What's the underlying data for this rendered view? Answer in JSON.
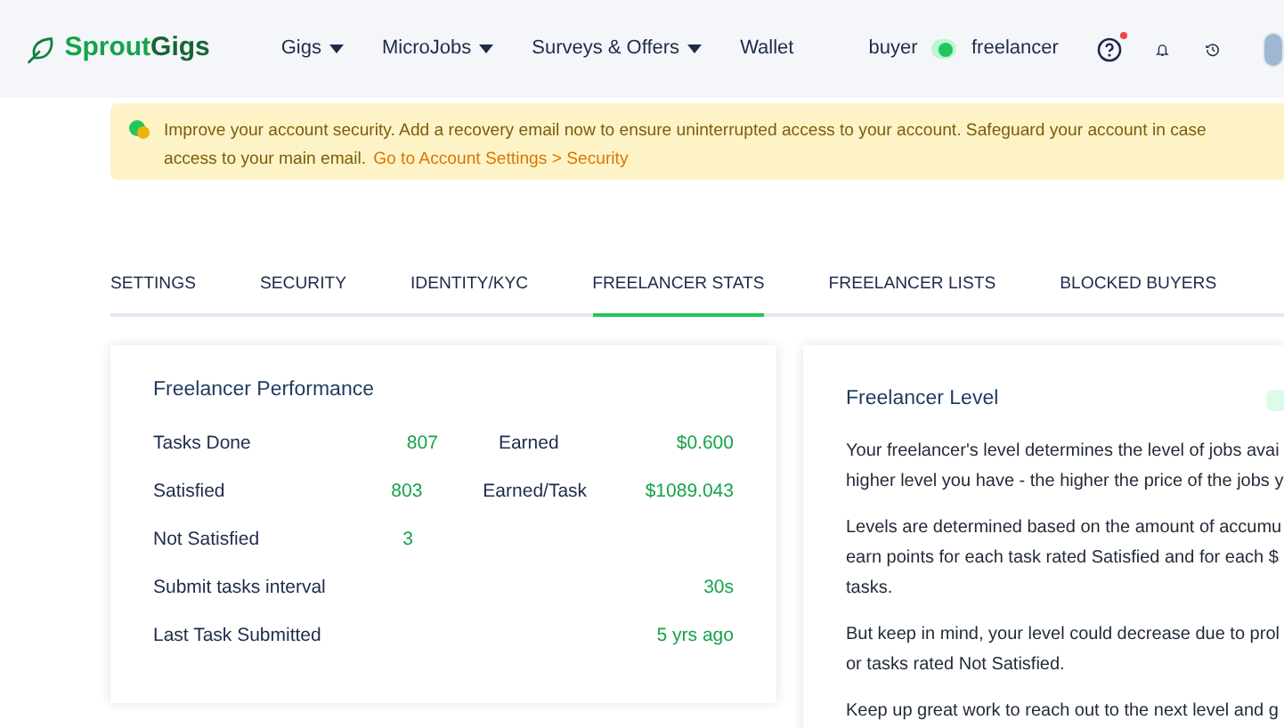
{
  "header": {
    "logo": {
      "part_1": "Sprout",
      "part_2": "Gigs"
    },
    "nav": [
      {
        "label": "Gigs",
        "dropdown": true
      },
      {
        "label": "MicroJobs",
        "dropdown": true
      },
      {
        "label": "Surveys & Offers",
        "dropdown": true
      },
      {
        "label": "Wallet",
        "dropdown": false
      }
    ],
    "role_switch": {
      "left": "buyer",
      "right": "freelancer",
      "on": true
    },
    "help_notification": true
  },
  "banner": {
    "lines": [
      "Improve your account security. Add a recovery email now to ensure uninterrupted access to your account. Safeguard your account in case"
    ],
    "last_line": "access to your main email.",
    "link": "Go to Account Settings > Security"
  },
  "tabs": [
    {
      "label": "SETTINGS",
      "selected": false
    },
    {
      "label": "SECURITY",
      "selected": false
    },
    {
      "label": "IDENTITY/KYC",
      "selected": false
    },
    {
      "label": "FREELANCER STATS",
      "selected": true
    },
    {
      "label": "FREELANCER LISTS",
      "selected": false
    },
    {
      "label": "BLOCKED BUYERS",
      "selected": false
    }
  ],
  "performance": {
    "title": "Freelancer Performance",
    "rows": [
      {
        "label": "Tasks Done",
        "value": "807",
        "label_2": "Earned",
        "value_2": "$0.600"
      },
      {
        "label": "Satisfied",
        "value": "803",
        "label_2": "Earned/Task",
        "value_2": "$1089.043"
      },
      {
        "label": "Not Satisfied",
        "value": "3"
      },
      {
        "label": "Submit tasks interval",
        "value": "30s"
      },
      {
        "label": "Last Task Submitted",
        "value": "5 yrs ago"
      }
    ]
  },
  "level": {
    "title": "Freelancer Level",
    "paragraphs": [
      [
        "Your freelancer's level determines the level of jobs avai",
        "higher level you have - the higher the price of the jobs y"
      ],
      [
        "Levels are determined based on the amount of accumu",
        "earn points for each task rated Satisfied and for each $",
        "tasks."
      ],
      [
        "But keep in mind, your level could decrease due to prol",
        "or tasks rated Not Satisfied."
      ],
      [
        "Keep up great work to reach out to the next level and g"
      ]
    ]
  }
}
